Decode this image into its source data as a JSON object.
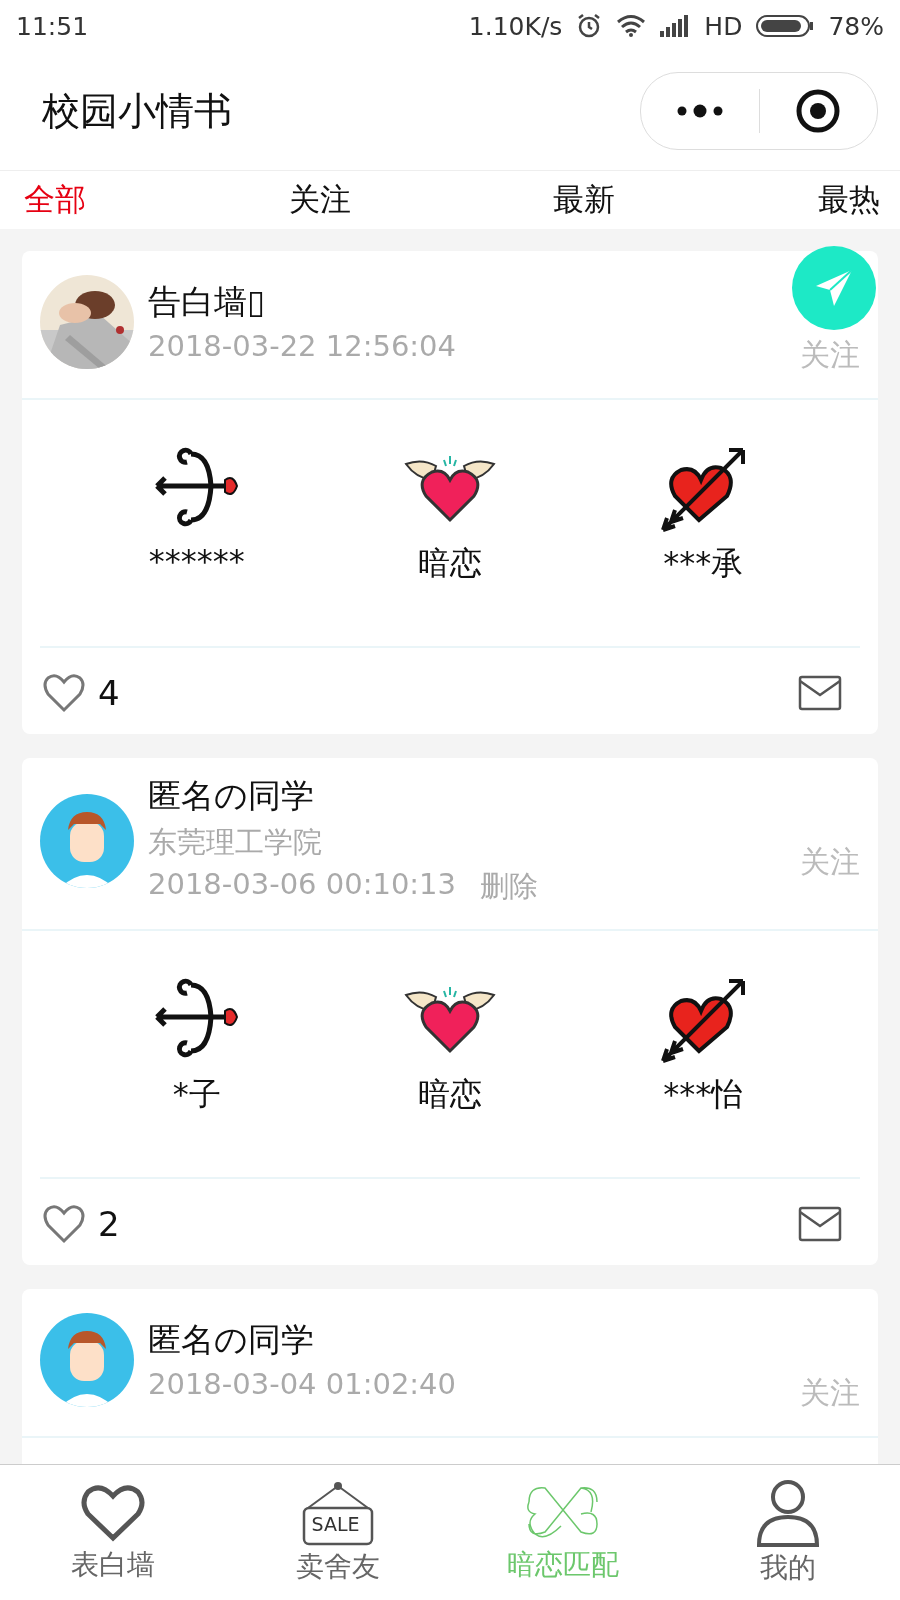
{
  "status_bar": {
    "time": "11:51",
    "speed": "1.10K/s",
    "network": "HD",
    "battery": "78%"
  },
  "header": {
    "title": "校园小情书"
  },
  "tabs": [
    {
      "label": "全部",
      "selected": true
    },
    {
      "label": "关注",
      "selected": false
    },
    {
      "label": "最新",
      "selected": false
    },
    {
      "label": "最热",
      "selected": false
    }
  ],
  "posts": [
    {
      "name": "告白墙▯",
      "time": "2018-03-22 12:56:04",
      "follow": "关注",
      "from": "******",
      "relation": "暗恋",
      "to": "***承",
      "likes": "4"
    },
    {
      "avatar": {
        "kind": "icon"
      },
      "name": "匿名の同学",
      "school": "东莞理工学院",
      "time": "2018-03-06 00:10:13",
      "delete": "删除",
      "follow": "关注",
      "from": "*子",
      "relation": "暗恋",
      "to": "***怡",
      "likes": "2"
    },
    {
      "avatar": {
        "kind": "icon"
      },
      "name": "匿名の同学",
      "time": "2018-03-04 01:02:40",
      "follow": "关注"
    }
  ],
  "bottom_nav": [
    {
      "kind": "heart",
      "label": "表白墙",
      "selected": false
    },
    {
      "kind": "sign",
      "label": "卖舍友",
      "icon_text": "SALE",
      "selected": false
    },
    {
      "kind": "match",
      "label": "暗恋匹配",
      "selected": true
    },
    {
      "kind": "person",
      "label": "我的",
      "selected": false
    }
  ]
}
